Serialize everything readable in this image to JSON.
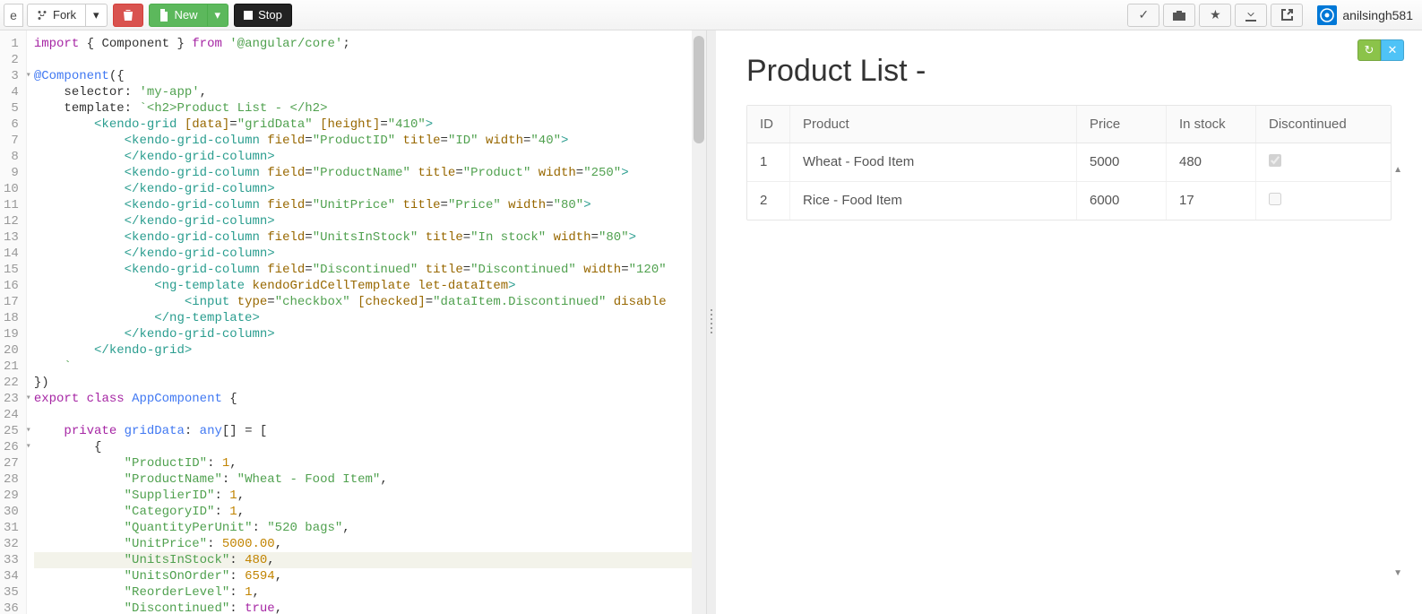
{
  "toolbar": {
    "fork_label": "Fork",
    "new_label": "New",
    "stop_label": "Stop"
  },
  "user": {
    "name": "anilsingh581"
  },
  "code_lines": [
    {
      "n": 1,
      "html": "<span class='tok-kw'>import</span> { Component } <span class='tok-kw'>from</span> <span class='tok-str'>'@angular/core'</span>;"
    },
    {
      "n": 2,
      "html": ""
    },
    {
      "n": 3,
      "fold": true,
      "html": "<span class='tok-id'>@Component</span>({"
    },
    {
      "n": 4,
      "html": "    selector: <span class='tok-str'>'my-app'</span>,"
    },
    {
      "n": 5,
      "html": "    template: <span class='tok-str'>`&lt;h2&gt;Product List - &lt;/h2&gt;</span>"
    },
    {
      "n": 6,
      "html": "        <span class='tok-tag'>&lt;kendo-grid</span> <span class='tok-attr'>[data]</span>=<span class='tok-str'>\"gridData\"</span> <span class='tok-attr'>[height]</span>=<span class='tok-str'>\"410\"</span><span class='tok-tag'>&gt;</span>"
    },
    {
      "n": 7,
      "html": "            <span class='tok-tag'>&lt;kendo-grid-column</span> <span class='tok-attr'>field</span>=<span class='tok-str'>\"ProductID\"</span> <span class='tok-attr'>title</span>=<span class='tok-str'>\"ID\"</span> <span class='tok-attr'>width</span>=<span class='tok-str'>\"40\"</span><span class='tok-tag'>&gt;</span>"
    },
    {
      "n": 8,
      "html": "            <span class='tok-tag'>&lt;/kendo-grid-column&gt;</span>"
    },
    {
      "n": 9,
      "html": "            <span class='tok-tag'>&lt;kendo-grid-column</span> <span class='tok-attr'>field</span>=<span class='tok-str'>\"ProductName\"</span> <span class='tok-attr'>title</span>=<span class='tok-str'>\"Product\"</span> <span class='tok-attr'>width</span>=<span class='tok-str'>\"250\"</span><span class='tok-tag'>&gt;</span>"
    },
    {
      "n": 10,
      "html": "            <span class='tok-tag'>&lt;/kendo-grid-column&gt;</span>"
    },
    {
      "n": 11,
      "html": "            <span class='tok-tag'>&lt;kendo-grid-column</span> <span class='tok-attr'>field</span>=<span class='tok-str'>\"UnitPrice\"</span> <span class='tok-attr'>title</span>=<span class='tok-str'>\"Price\"</span> <span class='tok-attr'>width</span>=<span class='tok-str'>\"80\"</span><span class='tok-tag'>&gt;</span>"
    },
    {
      "n": 12,
      "html": "            <span class='tok-tag'>&lt;/kendo-grid-column&gt;</span>"
    },
    {
      "n": 13,
      "html": "            <span class='tok-tag'>&lt;kendo-grid-column</span> <span class='tok-attr'>field</span>=<span class='tok-str'>\"UnitsInStock\"</span> <span class='tok-attr'>title</span>=<span class='tok-str'>\"In stock\"</span> <span class='tok-attr'>width</span>=<span class='tok-str'>\"80\"</span><span class='tok-tag'>&gt;</span>"
    },
    {
      "n": 14,
      "html": "            <span class='tok-tag'>&lt;/kendo-grid-column&gt;</span>"
    },
    {
      "n": 15,
      "html": "            <span class='tok-tag'>&lt;kendo-grid-column</span> <span class='tok-attr'>field</span>=<span class='tok-str'>\"Discontinued\"</span> <span class='tok-attr'>title</span>=<span class='tok-str'>\"Discontinued\"</span> <span class='tok-attr'>width</span>=<span class='tok-str'>\"120\"</span>"
    },
    {
      "n": 16,
      "html": "                <span class='tok-tag'>&lt;ng-template</span> <span class='tok-attr'>kendoGridCellTemplate</span> <span class='tok-attr'>let-dataItem</span><span class='tok-tag'>&gt;</span>"
    },
    {
      "n": 17,
      "html": "                    <span class='tok-tag'>&lt;input</span> <span class='tok-attr'>type</span>=<span class='tok-str'>\"checkbox\"</span> <span class='tok-attr'>[checked]</span>=<span class='tok-str'>\"dataItem.Discontinued\"</span> <span class='tok-attr'>disable</span>"
    },
    {
      "n": 18,
      "html": "                <span class='tok-tag'>&lt;/ng-template&gt;</span>"
    },
    {
      "n": 19,
      "html": "            <span class='tok-tag'>&lt;/kendo-grid-column&gt;</span>"
    },
    {
      "n": 20,
      "html": "        <span class='tok-tag'>&lt;/kendo-grid&gt;</span>"
    },
    {
      "n": 21,
      "html": "    <span class='tok-str'>`</span>"
    },
    {
      "n": 22,
      "html": "})"
    },
    {
      "n": 23,
      "fold": true,
      "html": "<span class='tok-kw'>export</span> <span class='tok-kw'>class</span> <span class='tok-id'>AppComponent</span> {"
    },
    {
      "n": 24,
      "html": ""
    },
    {
      "n": 25,
      "fold": true,
      "html": "    <span class='tok-kw'>private</span> <span class='tok-id'>gridData</span>: <span class='tok-id'>any</span>[] = ["
    },
    {
      "n": 26,
      "fold": true,
      "html": "        {"
    },
    {
      "n": 27,
      "html": "            <span class='tok-str'>\"ProductID\"</span>: <span class='tok-num'>1</span>,"
    },
    {
      "n": 28,
      "html": "            <span class='tok-str'>\"ProductName\"</span>: <span class='tok-str'>\"Wheat - Food Item\"</span>,"
    },
    {
      "n": 29,
      "html": "            <span class='tok-str'>\"SupplierID\"</span>: <span class='tok-num'>1</span>,"
    },
    {
      "n": 30,
      "html": "            <span class='tok-str'>\"CategoryID\"</span>: <span class='tok-num'>1</span>,"
    },
    {
      "n": 31,
      "html": "            <span class='tok-str'>\"QuantityPerUnit\"</span>: <span class='tok-str'>\"520 bags\"</span>,"
    },
    {
      "n": 32,
      "html": "            <span class='tok-str'>\"UnitPrice\"</span>: <span class='tok-num'>5000.00</span>,"
    },
    {
      "n": 33,
      "hl": true,
      "html": "            <span class='tok-str'>\"UnitsInStock\"</span>: <span class='tok-num'>480</span>,"
    },
    {
      "n": 34,
      "html": "            <span class='tok-str'>\"UnitsOnOrder\"</span>: <span class='tok-num'>6594</span>,"
    },
    {
      "n": 35,
      "html": "            <span class='tok-str'>\"ReorderLevel\"</span>: <span class='tok-num'>1</span>,"
    },
    {
      "n": 36,
      "html": "            <span class='tok-str'>\"Discontinued\"</span>: <span class='tok-kw'>true</span>,"
    }
  ],
  "preview": {
    "title": "Product List -",
    "columns": [
      "ID",
      "Product",
      "Price",
      "In stock",
      "Discontinued"
    ],
    "rows": [
      {
        "id": "1",
        "product": "Wheat - Food Item",
        "price": "5000",
        "stock": "480",
        "disc": true
      },
      {
        "id": "2",
        "product": "Rice - Food Item",
        "price": "6000",
        "stock": "17",
        "disc": false
      }
    ]
  }
}
